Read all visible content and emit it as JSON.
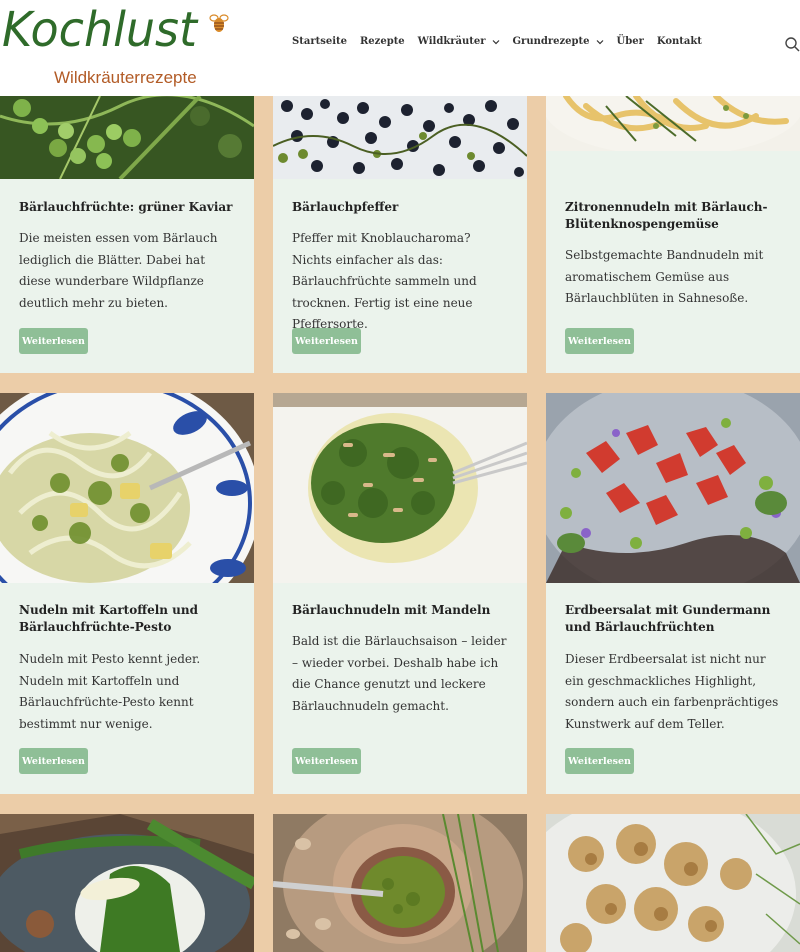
{
  "header": {
    "logo_title": "Kochlust",
    "logo_subtitle": "Wildkräuterrezepte",
    "nav": [
      {
        "label": "Startseite",
        "dropdown": false
      },
      {
        "label": "Rezepte",
        "dropdown": false
      },
      {
        "label": "Wildkräuter",
        "dropdown": true
      },
      {
        "label": "Grundrezepte",
        "dropdown": true
      },
      {
        "label": "Über",
        "dropdown": false
      },
      {
        "label": "Kontakt",
        "dropdown": false
      }
    ],
    "search_icon": "search-icon"
  },
  "colors": {
    "background": "#eccda8",
    "card": "#ebf3ec",
    "button": "#8fbf97",
    "logo_green": "#2f6b2a",
    "logo_orange": "#b25b26"
  },
  "cards": [
    {
      "title": "Bärlauchfrüchte: grüner Kaviar",
      "excerpt": "Die meisten essen vom Bärlauch lediglich die Blätter. Dabei hat diese wunderbare Wildpflanze deutlich mehr zu bieten.",
      "button": "Weiterlesen",
      "image": "green berries"
    },
    {
      "title": "Bärlauchpfeffer",
      "excerpt": "Pfeffer mit Knoblaucharoma? Nichts einfacher als das: Bärlauchfrüchte sammeln und trocknen. Fertig ist eine neue Pfeffersorte.",
      "button": "Weiterlesen",
      "image": "dried pepper"
    },
    {
      "title": "Zitronennudeln mit Bärlauch-Blütenknospengemüse",
      "excerpt": "Selbstgemachte Bandnudeln mit aromatischem Gemüse aus Bärlauchblüten in Sahnesoße.",
      "button": "Weiterlesen",
      "image": "lemon noodles"
    },
    {
      "title": "Nudeln mit Kartoffeln und Bärlauchfrüchte-Pesto",
      "excerpt": "Nudeln mit Pesto kennt jeder. Nudeln mit Kartoffeln und Bärlauchfrüchte-Pesto kennt bestimmt nur wenige.",
      "button": "Weiterlesen",
      "image": "pesto pasta"
    },
    {
      "title": "Bärlauchnudeln mit Mandeln",
      "excerpt": "Bald ist die Bärlauchsaison – leider – wieder vorbei. Deshalb habe ich die Chance genutzt und leckere Bärlauchnudeln gemacht.",
      "button": "Weiterlesen",
      "image": "noodles almonds"
    },
    {
      "title": "Erdbeersalat mit Gundermann und Bärlauchfrüchten",
      "excerpt": "Dieser Erdbeersalat ist nicht nur ein geschmackliches Highlight, sondern auch ein farbenprächtiges Kunstwerk auf dem Teller.",
      "button": "Weiterlesen",
      "image": "strawberry salad"
    },
    {
      "title": "",
      "excerpt": "",
      "button": "",
      "image": "asparagus dish"
    },
    {
      "title": "",
      "excerpt": "",
      "button": "",
      "image": "pesto bowl"
    },
    {
      "title": "",
      "excerpt": "",
      "button": "",
      "image": "fried flowers"
    }
  ]
}
